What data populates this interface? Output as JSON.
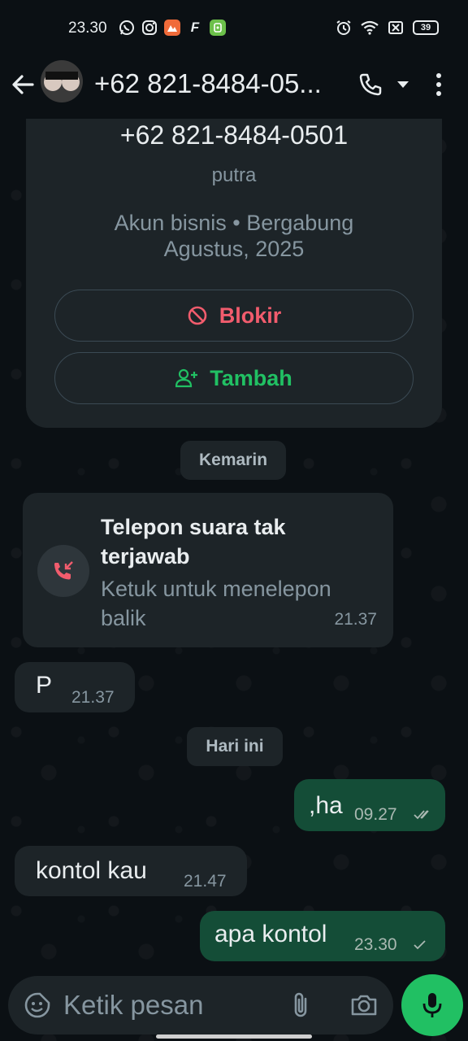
{
  "status_bar": {
    "time": "23.30",
    "battery": "39",
    "app_icons": [
      "whatsapp-icon",
      "instagram-icon",
      "app-orange-icon",
      "app-f-icon",
      "app-green-icon"
    ],
    "system_icons": [
      "alarm-icon",
      "wifi-icon",
      "sim-off-icon",
      "battery-icon"
    ]
  },
  "header": {
    "contact_name": "+62 821-8484-05...",
    "icons": [
      "back-arrow-icon",
      "phone-icon",
      "dropdown-icon",
      "more-vert-icon"
    ]
  },
  "profile_card": {
    "phone": "+62 821-8484-0501",
    "subtitle": "putra",
    "info": "Akun bisnis • Bergabung Agustus, 2025",
    "block_label": "Blokir",
    "add_label": "Tambah"
  },
  "chips": {
    "yesterday": "Kemarin",
    "today": "Hari ini"
  },
  "messages": [
    {
      "type": "missed_call",
      "direction": "in",
      "title": "Telepon suara tak terjawab",
      "subtitle": "Ketuk untuk menelepon balik",
      "time": "21.37"
    },
    {
      "type": "text",
      "direction": "in",
      "text": "P",
      "time": "21.37"
    },
    {
      "type": "text",
      "direction": "out",
      "text": ",ha",
      "time": "09.27",
      "status": "read"
    },
    {
      "type": "text",
      "direction": "in",
      "text": "kontol kau",
      "time": "21.47"
    },
    {
      "type": "text",
      "direction": "out",
      "text": "apa kontol",
      "time": "23.30",
      "status": "sent"
    }
  ],
  "input": {
    "placeholder": "Ketik pesan",
    "icons": [
      "sticker-icon",
      "attach-icon",
      "camera-icon",
      "mic-icon"
    ]
  },
  "colors": {
    "background": "#0b1014",
    "bubble_in": "#1d2428",
    "bubble_out": "#144d37",
    "accent_green": "#21c063",
    "danger_red": "#f15c6d",
    "missed_call_red": "#f15c6d",
    "read_tick": "#aab9b2"
  }
}
